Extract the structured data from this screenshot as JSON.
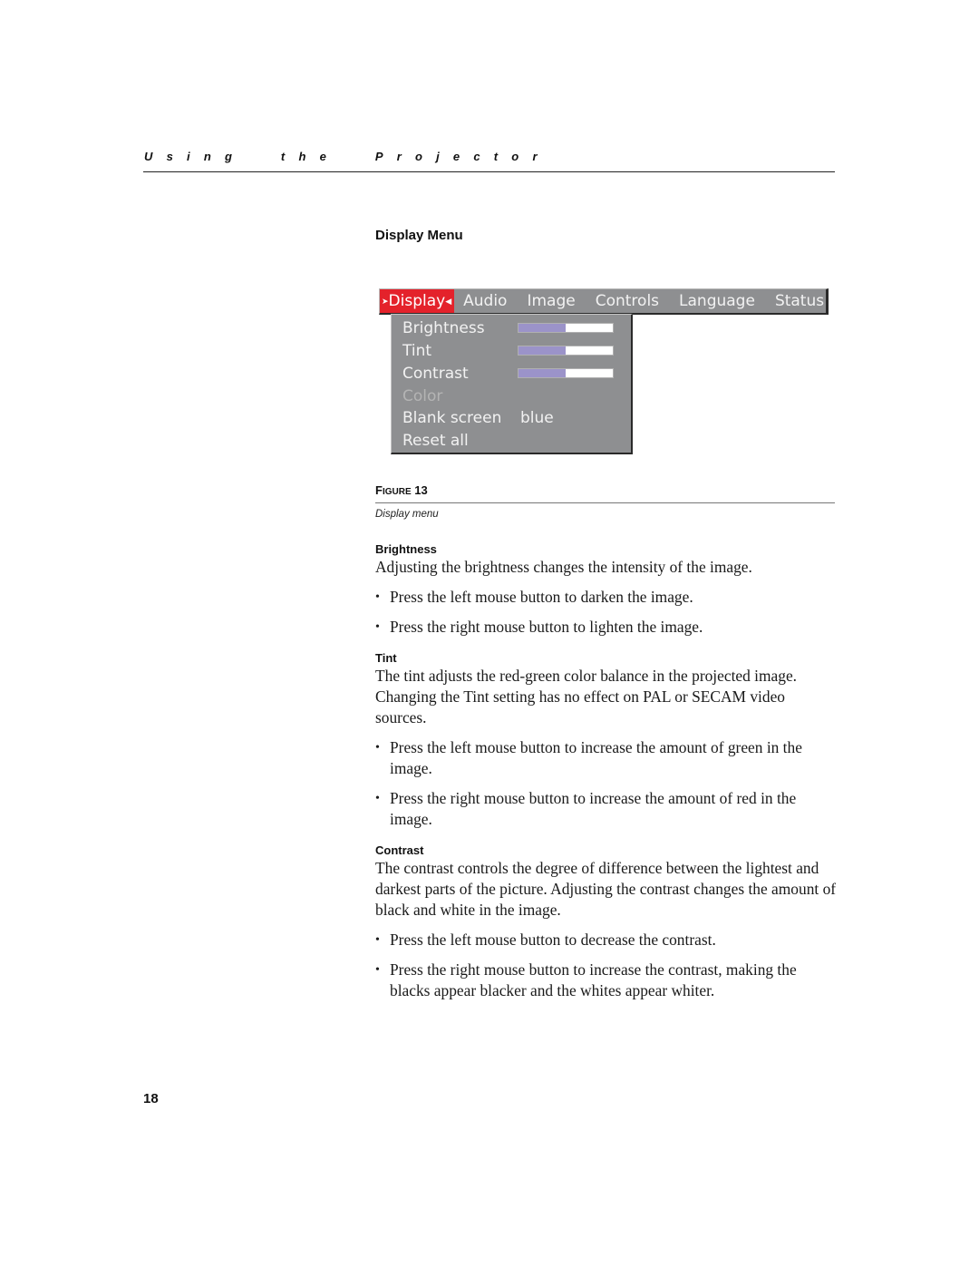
{
  "running_header": "Using the Projector",
  "section_title": "Display Menu",
  "osd_menu": {
    "colors": {
      "menu_bg": "#8e8f91",
      "active_tab_bg": "#e4222b",
      "slider_fill": "#9b93c9",
      "slider_track": "#ffffff",
      "text": "#f2f2f2",
      "disabled_text": "#b4b4b4"
    },
    "active_arrow_left": "➤",
    "active_arrow_right": "◀",
    "tabs": [
      {
        "label": "Display",
        "active": true
      },
      {
        "label": "Audio",
        "active": false
      },
      {
        "label": "Image",
        "active": false
      },
      {
        "label": "Controls",
        "active": false
      },
      {
        "label": "Language",
        "active": false
      },
      {
        "label": "Status",
        "active": false
      }
    ],
    "items": [
      {
        "label": "Brightness",
        "type": "slider",
        "value_fraction": 0.5,
        "enabled": true
      },
      {
        "label": "Tint",
        "type": "slider",
        "value_fraction": 0.5,
        "enabled": true
      },
      {
        "label": "Contrast",
        "type": "slider",
        "value_fraction": 0.5,
        "enabled": true
      },
      {
        "label": "Color",
        "type": "item",
        "enabled": false
      },
      {
        "label": "Blank screen",
        "type": "value",
        "value": "blue",
        "enabled": true
      },
      {
        "label": "Reset all",
        "type": "item",
        "enabled": true
      }
    ]
  },
  "figure": {
    "label_prefix_big": "F",
    "label_prefix_small": "IGURE",
    "number": "13",
    "caption": "Display menu"
  },
  "sections": [
    {
      "heading": "Brightness",
      "paragraph": "Adjusting the brightness changes the intensity of the image.",
      "bullets": [
        "Press the left mouse button to darken the image.",
        "Press the right mouse button to lighten the image."
      ]
    },
    {
      "heading": "Tint",
      "paragraph": "The tint adjusts the red-green color balance in the projected image. Changing the Tint setting has no effect on PAL or SECAM video sources.",
      "bullets": [
        "Press the left mouse button to increase the amount of green in the image.",
        "Press the right mouse button to increase the amount of red in the image."
      ]
    },
    {
      "heading": "Contrast",
      "paragraph": "The contrast controls the degree of difference between the lightest and darkest parts of the picture. Adjusting the contrast changes the amount of black and white in the image.",
      "bullets": [
        "Press the left mouse button to decrease the contrast.",
        "Press the right mouse button to increase the contrast, making the blacks appear blacker and the whites appear whiter."
      ]
    }
  ],
  "page_number": "18"
}
